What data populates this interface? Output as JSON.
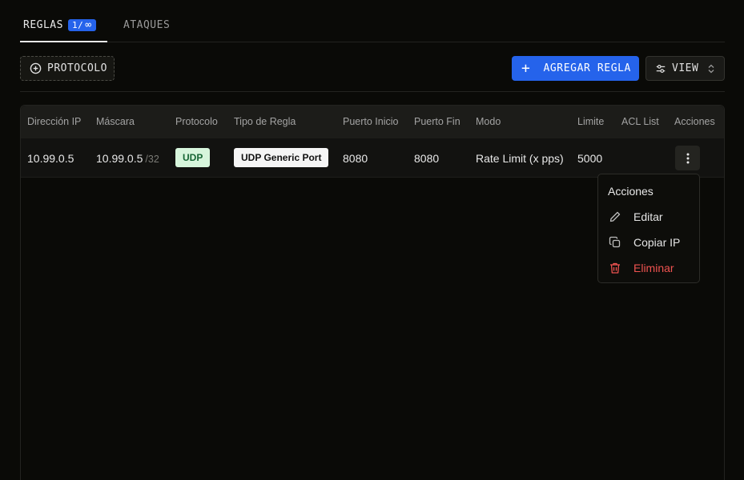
{
  "tabs": {
    "reglas": {
      "label": "REGLAS",
      "badge_count": "1/",
      "badge_symbol": "∞"
    },
    "ataques": {
      "label": "ATAQUES"
    }
  },
  "toolbar": {
    "protocolo_label": "PROTOCOLO",
    "agregar_label": "AGREGAR REGLA",
    "view_label": "VIEW"
  },
  "table": {
    "columns": [
      "Dirección IP",
      "Máscara",
      "Protocolo",
      "Tipo de Regla",
      "Puerto Inicio",
      "Puerto Fin",
      "Modo",
      "Limite",
      "ACL List",
      "Acciones"
    ],
    "rows": [
      {
        "ip": "10.99.0.5",
        "mask": "10.99.0.5",
        "mask_suffix": "/32",
        "protocol": "UDP",
        "rule_type": "UDP Generic Port",
        "port_start": "8080",
        "port_end": "8080",
        "mode": "Rate Limit (x pps)",
        "limit": "5000",
        "acl": ""
      }
    ]
  },
  "menu": {
    "title": "Acciones",
    "items": [
      {
        "label": "Editar",
        "icon": "pencil-icon"
      },
      {
        "label": "Copiar IP",
        "icon": "copy-icon"
      },
      {
        "label": "Eliminar",
        "icon": "trash-icon"
      }
    ]
  },
  "colors": {
    "accent": "#2563eb",
    "udp_bg": "#d7f5dc",
    "udp_text": "#166534",
    "danger": "#ef5350",
    "background": "#0a0a07"
  }
}
